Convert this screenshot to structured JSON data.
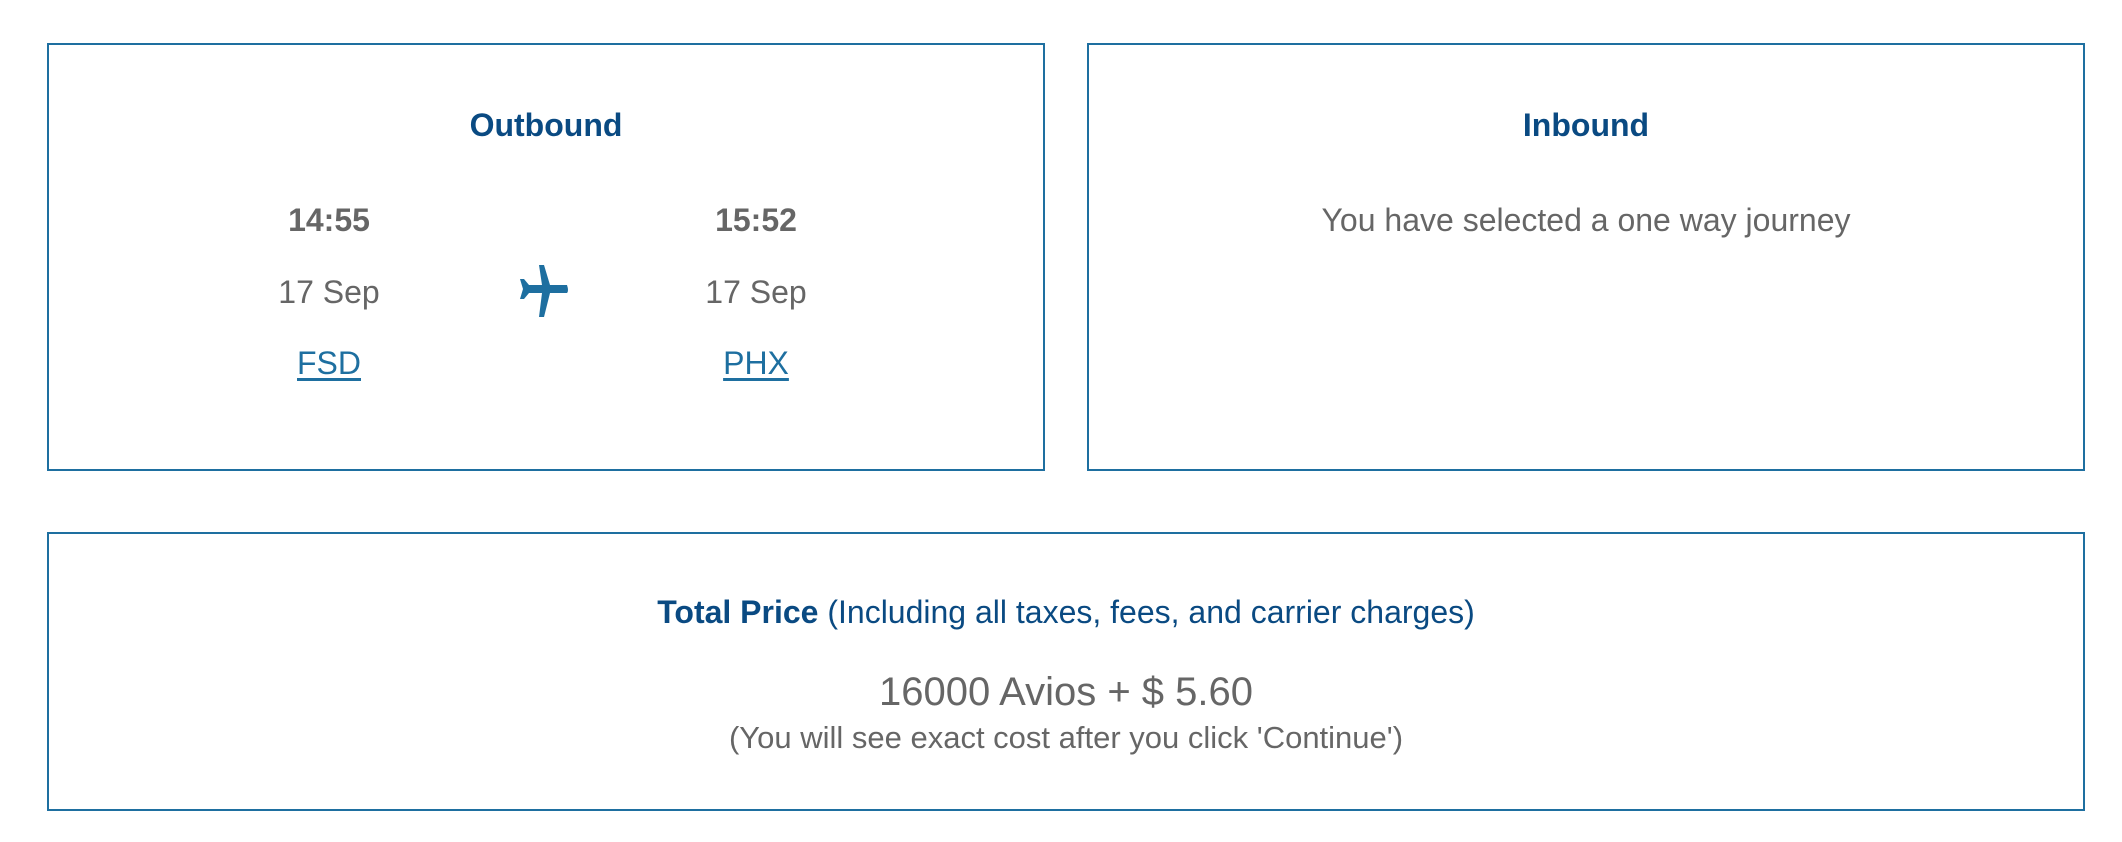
{
  "outbound": {
    "title": "Outbound",
    "departure": {
      "time": "14:55",
      "date": "17 Sep",
      "airport": "FSD"
    },
    "arrival": {
      "time": "15:52",
      "date": "17 Sep",
      "airport": "PHX"
    },
    "icon": "airplane-icon"
  },
  "inbound": {
    "title": "Inbound",
    "message": "You have selected a one way journey"
  },
  "price": {
    "label": "Total Price",
    "label_note": "(Including all taxes, fees, and carrier charges)",
    "value": "16000 Avios + $ 5.60",
    "note": "(You will see exact cost after you click 'Continue')"
  },
  "colors": {
    "accent": "#1e6fa0",
    "title": "#0a4a82",
    "text": "#666666"
  }
}
